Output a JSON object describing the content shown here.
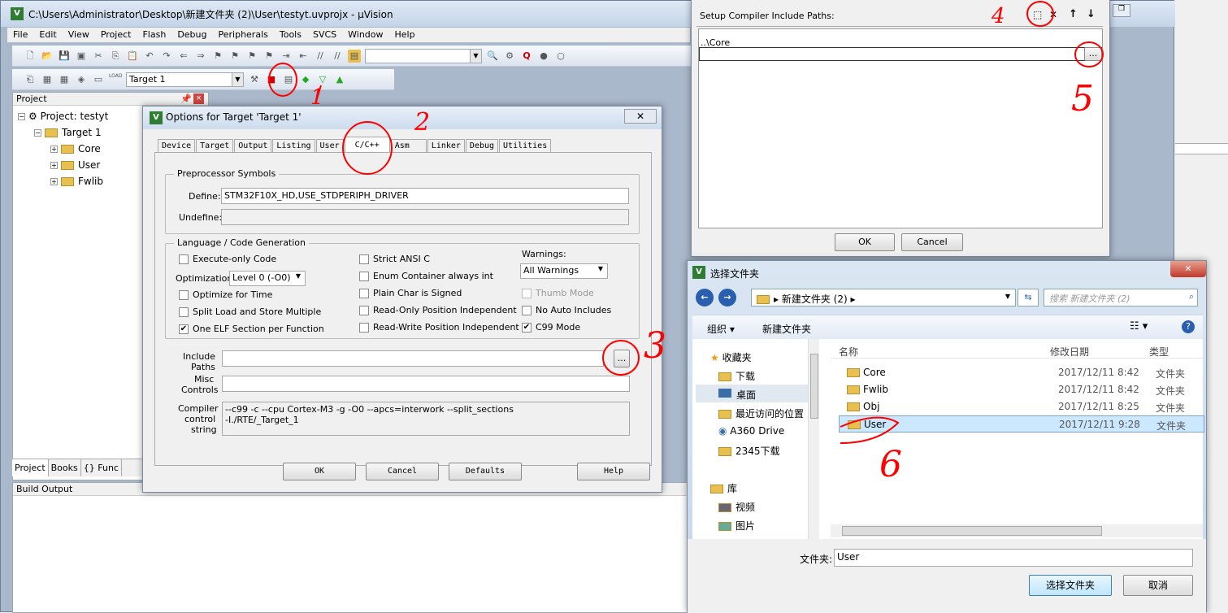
{
  "window": {
    "title": "C:\\Users\\Administrator\\Desktop\\新建文件夹 (2)\\User\\testyt.uvprojx - μVision",
    "icon": "uvision-icon"
  },
  "menu": [
    "File",
    "Edit",
    "View",
    "Project",
    "Flash",
    "Debug",
    "Peripherals",
    "Tools",
    "SVCS",
    "Window",
    "Help"
  ],
  "toolbar": {
    "target": "Target 1",
    "load_label": "LOAD"
  },
  "project_panel": {
    "title": "Project",
    "root": "Project: testyt",
    "target": "Target 1",
    "groups": [
      "Core",
      "User",
      "Fwlib"
    ],
    "tabs": [
      "Project",
      "Books",
      "{} Func"
    ]
  },
  "build_output": {
    "title": "Build Output"
  },
  "options": {
    "title": "Options for Target 'Target 1'",
    "tabs": [
      "Device",
      "Target",
      "Output",
      "Listing",
      "User",
      "C/C++",
      "Asm",
      "Linker",
      "Debug",
      "Utilities"
    ],
    "active_tab": "C/C++",
    "preprocessor": {
      "title": "Preprocessor Symbols",
      "define_label": "Define:",
      "define": "STM32F10X_HD,USE_STDPERIPH_DRIVER",
      "undefine_label": "Undefine:",
      "undefine": ""
    },
    "lang": {
      "title": "Language / Code Generation",
      "execute_only": {
        "label": "Execute-only Code",
        "checked": false
      },
      "opt_label": "Optimization:",
      "optimization": "Level 0 (-O0)",
      "opt_time": {
        "label": "Optimize for Time",
        "checked": false
      },
      "split_ls": {
        "label": "Split Load and Store Multiple",
        "checked": false
      },
      "one_elf": {
        "label": "One ELF Section per Function",
        "checked": true
      },
      "strict_ansi": {
        "label": "Strict ANSI C",
        "checked": false
      },
      "enum_container": {
        "label": "Enum Container always int",
        "checked": false
      },
      "plain_char": {
        "label": "Plain Char is Signed",
        "checked": false
      },
      "ro_pi": {
        "label": "Read-Only Position Independent",
        "checked": false
      },
      "rw_pi": {
        "label": "Read-Write Position Independent",
        "checked": false
      },
      "warnings_label": "Warnings:",
      "warnings": "All Warnings",
      "thumb_mode": {
        "label": "Thumb Mode",
        "checked": false
      },
      "no_auto": {
        "label": "No Auto Includes",
        "checked": false
      },
      "c99": {
        "label": "C99 Mode",
        "checked": true
      }
    },
    "include_label_1": "Include",
    "include_label_2": "Paths",
    "include_paths": "",
    "browse": "...",
    "misc_label_1": "Misc",
    "misc_label_2": "Controls",
    "misc": "",
    "compiler_label_1": "Compiler",
    "compiler_label_2": "control",
    "compiler_label_3": "string",
    "compiler_line1": "--c99 -c --cpu Cortex-M3 -g -O0 --apcs=interwork --split_sections",
    "compiler_line2": "-I./RTE/_Target_1",
    "buttons": {
      "ok": "OK",
      "cancel": "Cancel",
      "defaults": "Defaults",
      "help": "Help"
    }
  },
  "include_dlg": {
    "title": "Setup Compiler Include Paths:",
    "entry": "..\\Core",
    "browse": "...",
    "ok": "OK",
    "cancel": "Cancel"
  },
  "folder_dlg": {
    "title": "选择文件夹",
    "path": "新建文件夹 (2)",
    "search_placeholder": "搜索 新建文件夹 (2)",
    "organize": "组织 ▾",
    "new_folder": "新建文件夹",
    "nav": [
      "收藏夹",
      "下载",
      "桌面",
      "最近访问的位置",
      "A360 Drive",
      "2345下载",
      "库",
      "视频",
      "图片"
    ],
    "columns": [
      "名称",
      "修改日期",
      "类型"
    ],
    "rows": [
      {
        "name": "Core",
        "date": "2017/12/11 8:42",
        "type": "文件夹"
      },
      {
        "name": "Fwlib",
        "date": "2017/12/11 8:42",
        "type": "文件夹"
      },
      {
        "name": "Obj",
        "date": "2017/12/11 8:25",
        "type": "文件夹"
      },
      {
        "name": "User",
        "date": "2017/12/11 9:28",
        "type": "文件夹"
      }
    ],
    "selected": "User",
    "folder_label": "文件夹:",
    "folder_value": "User",
    "select_btn": "选择文件夹",
    "cancel_btn": "取消"
  },
  "annotations": [
    "1",
    "2",
    "3",
    "4",
    "5",
    "6"
  ],
  "colors": {
    "annotation": "#ff0000",
    "selection": "#cce8ff",
    "title_gradient": "#cddcee"
  }
}
